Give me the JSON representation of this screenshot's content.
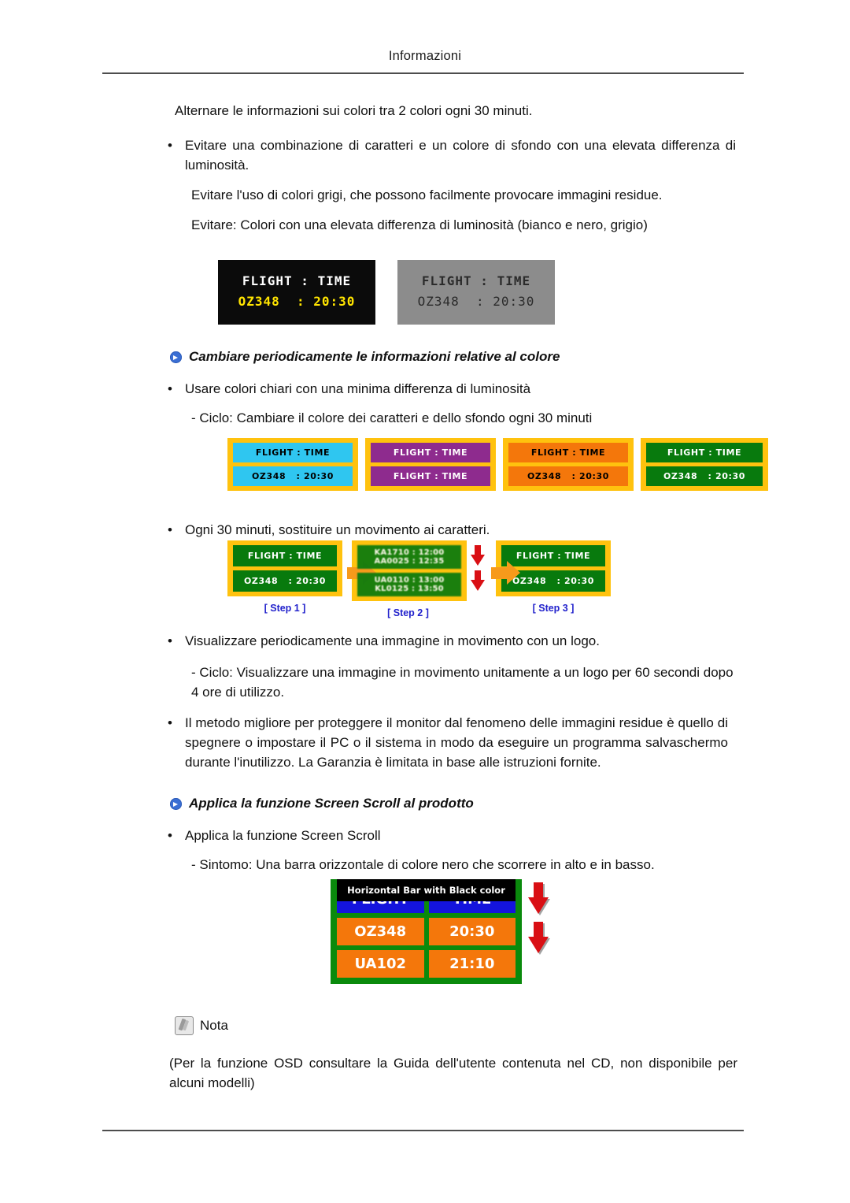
{
  "header": {
    "title": "Informazioni"
  },
  "body": {
    "lead": "Alternare le informazioni sui colori tra 2 colori ogni 30 minuti.",
    "bullet_avoid_combo": "Evitare una combinazione di caratteri e un colore di sfondo con una elevata differenza di luminosità.",
    "avoid_gray": "Evitare l'uso di colori grigi, che possono facilmente provocare immagini residue.",
    "avoid_high_contrast": "Evitare: Colori con una elevata differenza di luminosità (bianco e nero, grigio)"
  },
  "display_examples": {
    "black_panel": {
      "line1": "FLIGHT : TIME",
      "line2": "OZ348  : 20:30",
      "bg_color": "#0b0b0b",
      "line1_color": "#ffffff",
      "line2_color": "#ffe400"
    },
    "gray_panel": {
      "line1": "FLIGHT : TIME",
      "line2": "OZ348  : 20:30",
      "bg_color": "#8c8c8c",
      "text_color": "#2b2b2b"
    }
  },
  "section_color": {
    "title": "Cambiare periodicamente le informazioni relative al colore",
    "bullet": "Usare colori chiari con una minima differenza di luminosità",
    "cycle_note": "- Ciclo: Cambiare il colore dei caratteri e dello sfondo ogni 30 minuti",
    "boards": [
      {
        "name": "cyan-board",
        "frame_color": "#ffc20e",
        "cell_color": "#2fc6f0",
        "text_color": "#000000",
        "line1": "FLIGHT : TIME",
        "line2": "OZ348   : 20:30"
      },
      {
        "name": "purple-board",
        "frame_color": "#ffc20e",
        "cell_color": "#8e2b8e",
        "text_color": "#ffffff",
        "line1": "FLIGHT : TIME",
        "line2": "FLIGHT : TIME"
      },
      {
        "name": "orange-board",
        "frame_color": "#ffc20e",
        "cell_color": "#f4770b",
        "text_color": "#000000",
        "line1": "FLIGHT : TIME",
        "line2": "OZ348   : 20:30"
      },
      {
        "name": "green-board",
        "frame_color": "#ffc20e",
        "cell_color": "#087a0d",
        "text_color": "#ffffff",
        "line1": "FLIGHT : TIME",
        "line2": "OZ348   : 20:30"
      }
    ]
  },
  "section_motion": {
    "bullet": "Ogni 30 minuti, sostituire un movimento ai caratteri.",
    "steps": [
      {
        "label": "[ Step 1 ]",
        "line1": "FLIGHT : TIME",
        "line2": "OZ348   : 20:30"
      },
      {
        "label": "[ Step 2 ]",
        "line1": "KA1710 : 12:00\nAA0025 : 12:35",
        "line2": "UA0110 : 13:00\nKL0125 : 13:50"
      },
      {
        "label": "[ Step 3 ]",
        "line1": "FLIGHT : TIME",
        "line2": "OZ348   : 20:30"
      }
    ],
    "arrow_color": "#f79a1b",
    "down_arrow_color": "#d90f14",
    "step_label_color": "#2222cc"
  },
  "section_logo": {
    "bullet": "Visualizzare periodicamente una immagine in movimento con un logo.",
    "cycle_note": "- Ciclo: Visualizzare una immagine in movimento unitamente a un logo per 60 secondi dopo 4 ore di utilizzo.",
    "best_method": "Il metodo migliore per proteggere il monitor dal fenomeno delle immagini residue è quello di spegnere o impostare il PC o il sistema in modo da eseguire un programma salvaschermo durante l'inutilizzo. La Garanzia è limitata in base alle istruzioni fornite."
  },
  "section_scroll": {
    "title": "Applica la funzione Screen Scroll al prodotto",
    "bullet": "Applica la funzione Screen Scroll",
    "symptom": "- Sintomo: Una barra orizzontale di colore nero che scorrere in alto e in basso.",
    "illustration": {
      "bar_label": "Horizontal Bar with Black color",
      "board_border_color": "#0a8a0c",
      "rows": [
        {
          "left": "FLIGHT",
          "right": "TIME",
          "cell_color": "#1414dd"
        },
        {
          "left": "OZ348",
          "right": "20:30",
          "cell_color": "#f4770b"
        },
        {
          "left": "UA102",
          "right": "21:10",
          "cell_color": "#f4770b"
        }
      ]
    }
  },
  "note": {
    "label": "Nota",
    "text": "(Per la funzione OSD consultare la Guida dell'utente contenuta nel CD, non disponibile per alcuni modelli)"
  }
}
